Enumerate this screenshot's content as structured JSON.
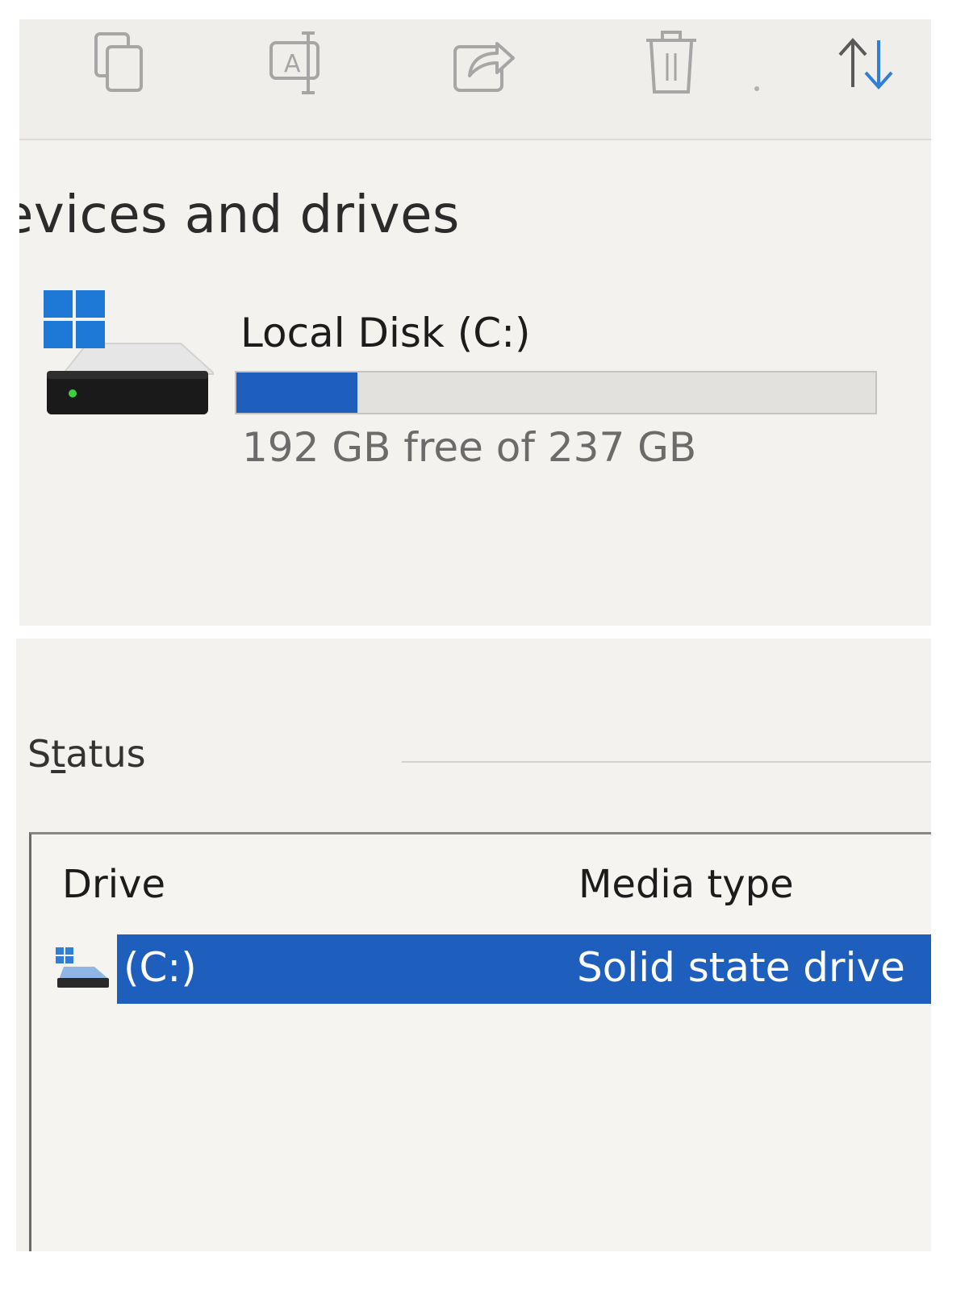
{
  "explorer": {
    "toolbar": {
      "icons": [
        "copy-icon",
        "rename-icon",
        "share-icon",
        "delete-icon",
        "sort-icon"
      ]
    },
    "section_title": "evices and drives",
    "drive": {
      "name": "Local Disk (C:)",
      "free_text": "192 GB free of 237 GB",
      "used_fraction": 0.19,
      "bar_color": "#1e5fbd"
    }
  },
  "optimize": {
    "status_label": "Status",
    "status_label_parts": {
      "pre": "S",
      "underlined": "t",
      "post": "atus"
    },
    "columns": {
      "drive": "Drive",
      "media_type": "Media type"
    },
    "rows": [
      {
        "drive": "(C:)",
        "media_type": "Solid state drive",
        "selected": true
      }
    ],
    "selection_color": "#1e5fbd"
  }
}
